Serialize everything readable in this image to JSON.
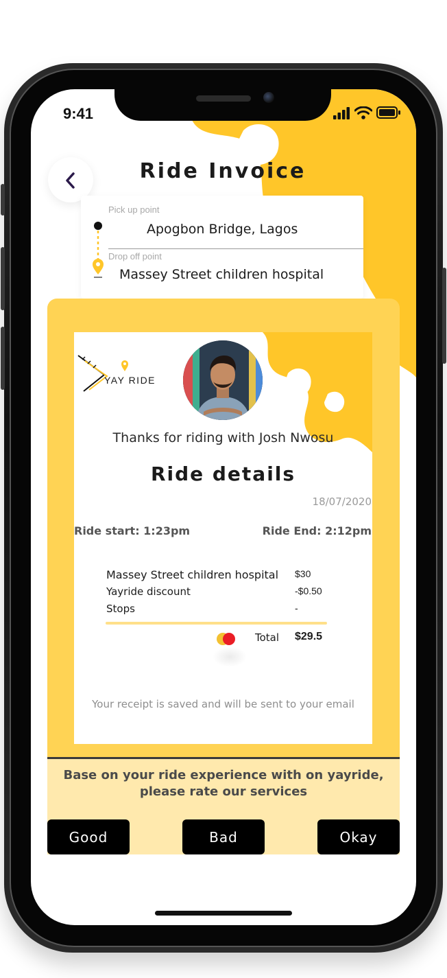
{
  "colors": {
    "accent": "#ffc629",
    "panel": "#ffd354",
    "rating_bg": "#ffe9ad",
    "button": "#000000"
  },
  "status_bar": {
    "time": "9:41"
  },
  "header": {
    "title": "Ride Invoice",
    "back_icon": "chevron-left-icon"
  },
  "route": {
    "pickup_label": "Pick up point",
    "pickup_value": "Apogbon Bridge, Lagos",
    "dropoff_label": "Drop off point",
    "dropoff_value": "Massey Street children hospital"
  },
  "receipt": {
    "brand": "YAY RIDE",
    "thanks": "Thanks for riding with Josh Nwosu",
    "title": "Ride details",
    "date": "18/07/2020",
    "ride_start": "Ride start: 1:23pm",
    "ride_end": "Ride End: 2:12pm",
    "items": [
      {
        "label": "Massey Street children hospital",
        "amount": "$30"
      },
      {
        "label": "Yayride discount",
        "amount": "-$0.50"
      },
      {
        "label": "Stops",
        "amount": "-"
      }
    ],
    "total_label": "Total",
    "total_amount": "$29.5",
    "note": "Your receipt is saved and will be sent to your email"
  },
  "rating": {
    "prompt_line1": "Base on your ride experience with on yayride,",
    "prompt_line2": "please rate our services",
    "buttons": [
      "Good",
      "Bad",
      "Okay"
    ]
  }
}
